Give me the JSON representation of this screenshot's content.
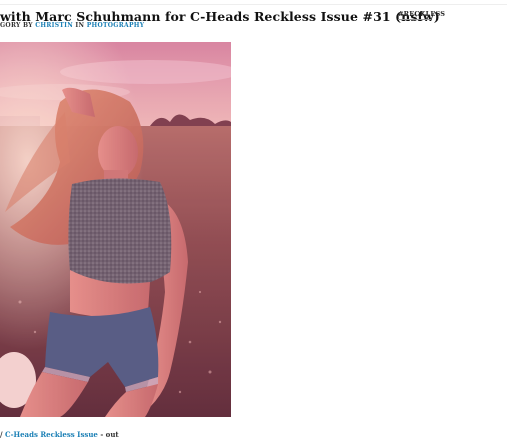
{
  "post": {
    "title": "with Marc Schuhmann for C-Heads Reckless Issue #31 (nsfw)",
    "meta_prefix": "GORY",
    "meta_author": "CHRISTIN",
    "meta_in": "IN",
    "meta_category": "PHOTOGRAPHY"
  },
  "tag": {
    "label": "#RECKLESS"
  },
  "credit": {
    "prefix": "/",
    "issue_link": "C-Heads Reckless Issue",
    "suffix": "- out"
  },
  "photo": {
    "subject": "girl-in-field-photo"
  },
  "colors": {
    "link": "#1a7fb5"
  }
}
